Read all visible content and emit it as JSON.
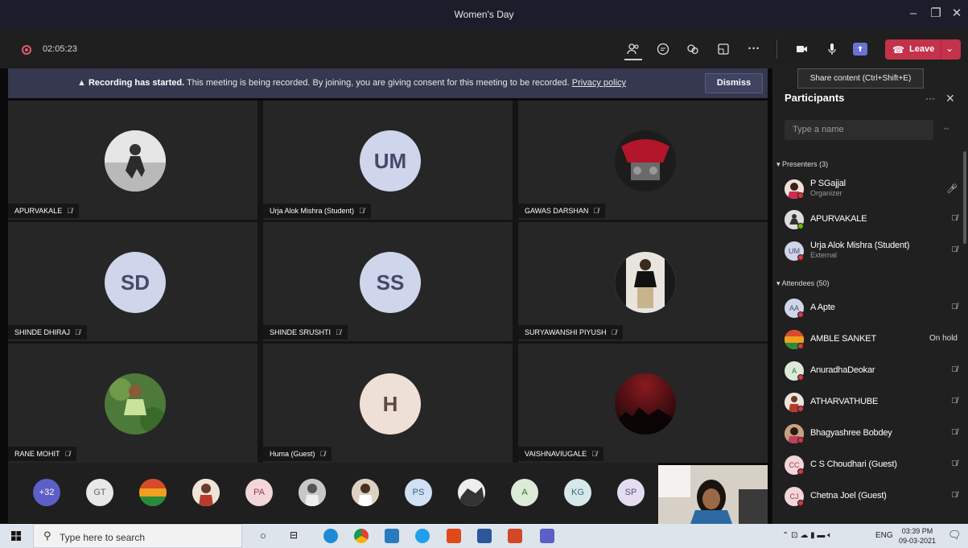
{
  "window": {
    "title": "Women's Day"
  },
  "toolbar": {
    "timer": "02:05:23",
    "leave_label": "Leave",
    "share_tooltip": "Share content (Ctrl+Shift+E)"
  },
  "banner": {
    "bold": "Recording has started.",
    "text": " This meeting is being recorded. By joining, you are giving consent for this meeting to be recorded. ",
    "link": "Privacy policy",
    "dismiss_label": "Dismiss"
  },
  "tiles": [
    {
      "name": "APURVAKALE",
      "avatar": "photo-silhouette"
    },
    {
      "name": "Urja Alok Mishra (Student)",
      "initials": "UM"
    },
    {
      "name": "GAWAS DARSHAN",
      "avatar": "photo-motorbike"
    },
    {
      "name": "SHINDE DHIRAJ",
      "initials": "SD"
    },
    {
      "name": "SHINDE SRUSHTI",
      "initials": "SS"
    },
    {
      "name": "SURYAWANSHI PIYUSH",
      "avatar": "photo-person"
    },
    {
      "name": "RANE MOHIT",
      "avatar": "photo-person-green"
    },
    {
      "name": "Huma (Guest)",
      "initials": "H"
    },
    {
      "name": "VAISHNAVIUGALE",
      "avatar": "photo-night-sky"
    }
  ],
  "strip": [
    "+32",
    "GT",
    "",
    "",
    "PA",
    "",
    "",
    "PS",
    "",
    "A",
    "KG",
    "SP"
  ],
  "panel": {
    "title": "Participants",
    "search_placeholder": "Type a name",
    "presenters_label": "Presenters (3)",
    "attendees_label": "Attendees (50)",
    "presenters": [
      {
        "name": "P SGajjal",
        "sub": "Organizer",
        "initials": "",
        "status": "red",
        "right": "mic-icon"
      },
      {
        "name": "APURVAKALE",
        "sub": "",
        "initials": "",
        "status": "green",
        "right": "mic-off-icon"
      },
      {
        "name": "Urja Alok Mishra (Student)",
        "sub": "External",
        "initials": "UM",
        "status": "red",
        "right": "mic-off-icon"
      }
    ],
    "attendees": [
      {
        "name": "A Apte",
        "initials": "AA",
        "status": "red",
        "right": "mic-off-icon"
      },
      {
        "name": "AMBLE SANKET",
        "initials": "",
        "status": "red",
        "right_text": "On hold"
      },
      {
        "name": "AnuradhaDeokar",
        "initials": "A",
        "status": "red",
        "right": "mic-off-icon"
      },
      {
        "name": "ATHARVATHUBE",
        "initials": "",
        "status": "red",
        "right": "mic-off-icon"
      },
      {
        "name": "Bhagyashree Bobdey",
        "initials": "",
        "status": "red",
        "right": "mic-off-icon"
      },
      {
        "name": "C S Choudhari (Guest)",
        "initials": "CC",
        "status": "red",
        "right": "mic-off-icon"
      },
      {
        "name": "Chetna Joel (Guest)",
        "initials": "CJ",
        "status": "red",
        "right": "mic-off-icon"
      }
    ]
  },
  "taskbar": {
    "search_placeholder": "Type here to search",
    "lang": "ENG",
    "time": "03:39 PM",
    "date": "09-03-2021"
  }
}
